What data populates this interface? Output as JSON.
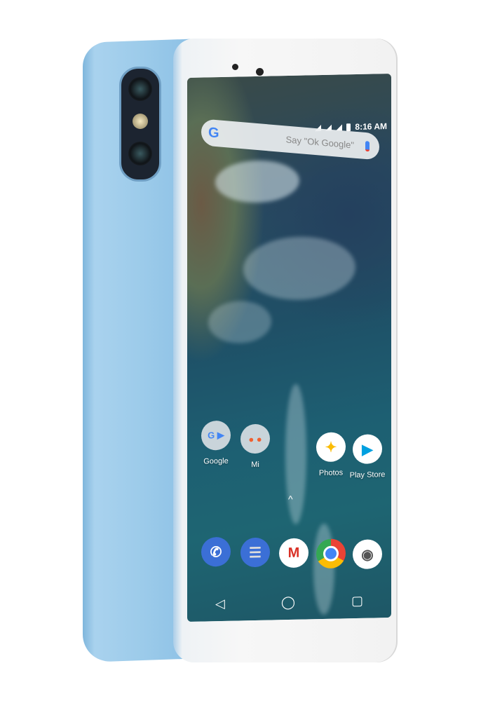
{
  "status_bar": {
    "time": "8:16 AM"
  },
  "search": {
    "logo": "G",
    "placeholder": "Say \"Ok Google\"",
    "mic_icon": "mic-icon"
  },
  "home_apps": [
    {
      "label": "Google",
      "icon": "google-folder-icon"
    },
    {
      "label": "Mi",
      "icon": "mi-folder-icon"
    },
    {
      "label": "Photos",
      "icon": "photos-icon"
    },
    {
      "label": "Play Store",
      "icon": "play-store-icon"
    }
  ],
  "dock": [
    {
      "icon": "phone-icon",
      "color": "#3b6fd6"
    },
    {
      "icon": "messages-icon",
      "color": "#3b6fd6"
    },
    {
      "icon": "gmail-icon",
      "color": "#ffffff"
    },
    {
      "icon": "chrome-icon",
      "color": "#ffffff"
    },
    {
      "icon": "camera-icon",
      "color": "#ffffff"
    }
  ],
  "nav": {
    "back": "◁",
    "home": "◯",
    "recents": "▢"
  },
  "colors": {
    "phone_body": "#9ccbea",
    "front_bezel": "#f5f5f5"
  }
}
